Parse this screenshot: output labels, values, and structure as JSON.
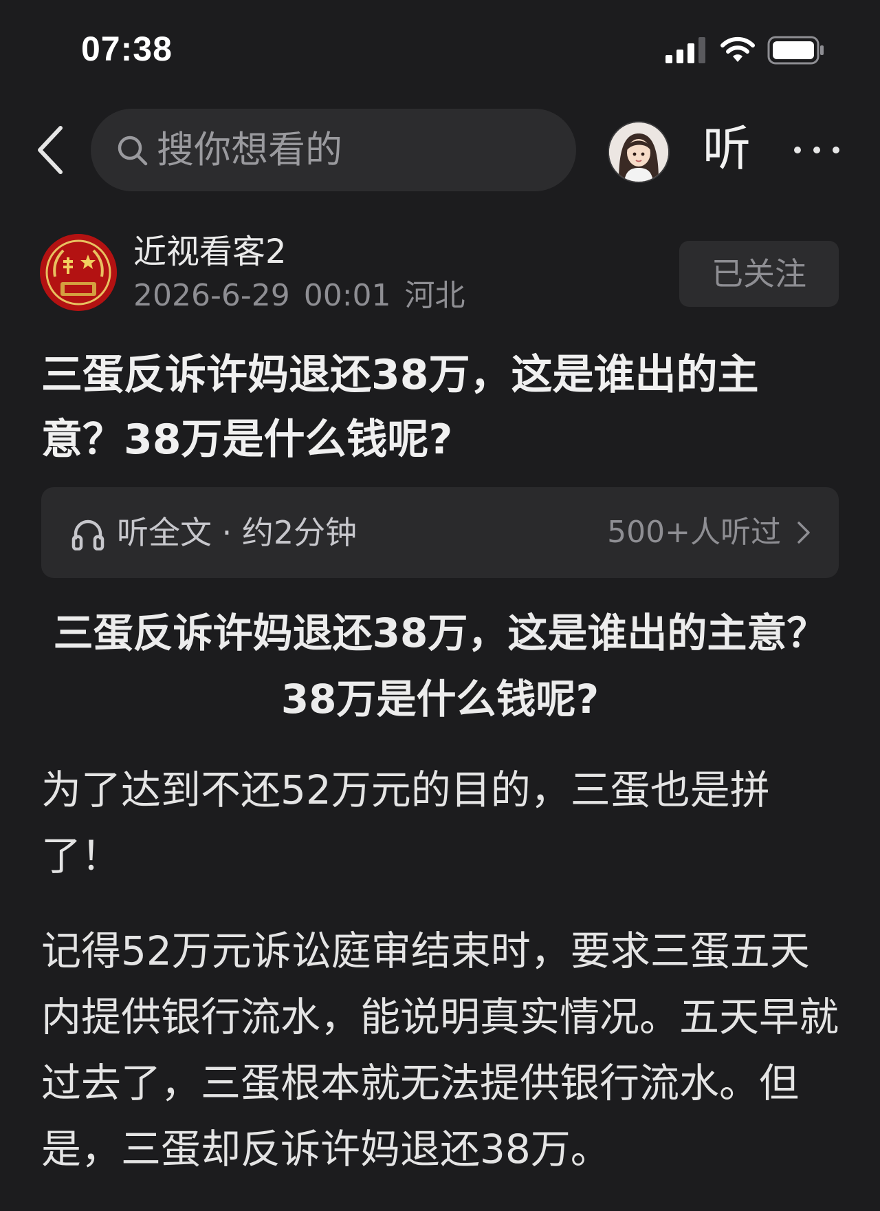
{
  "status_bar": {
    "time": "07:38"
  },
  "header": {
    "search_placeholder": "搜你想看的",
    "listen_label": "听"
  },
  "author": {
    "name": "近视看客2",
    "date": "2026-6-29",
    "time": "00:01",
    "location": "河北",
    "follow_label": "已关注"
  },
  "article": {
    "title": "三蛋反诉许妈退还38万，这是谁出的主意？38万是什么钱呢?",
    "audio": {
      "label": "听全文 · 约2分钟",
      "listeners": "500+人听过"
    },
    "heading": "三蛋反诉许妈退还38万，这是谁出的主意？38万是什么钱呢?",
    "paragraphs": [
      "为了达到不还52万元的目的，三蛋也是拼了！",
      "记得52万元诉讼庭审结束时，要求三蛋五天内提供银行流水，能说明真实情况。五天早就过去了，三蛋根本就无法提供银行流水。但是，三蛋却反诉许妈退还38万。"
    ]
  },
  "theme": {
    "background": "#1c1c1e",
    "surface": "#2c2c2e",
    "text_primary": "#e6e6e6",
    "text_secondary": "#8e8e93",
    "avatar_red": "#b01010"
  },
  "icons": {
    "back": "back-arrow-icon",
    "search": "search-icon",
    "more": "more-dots-icon",
    "headphone": "headphone-icon",
    "chevron": "chevron-right-icon",
    "signal": "signal-icon",
    "wifi": "wifi-icon",
    "battery": "battery-icon"
  }
}
